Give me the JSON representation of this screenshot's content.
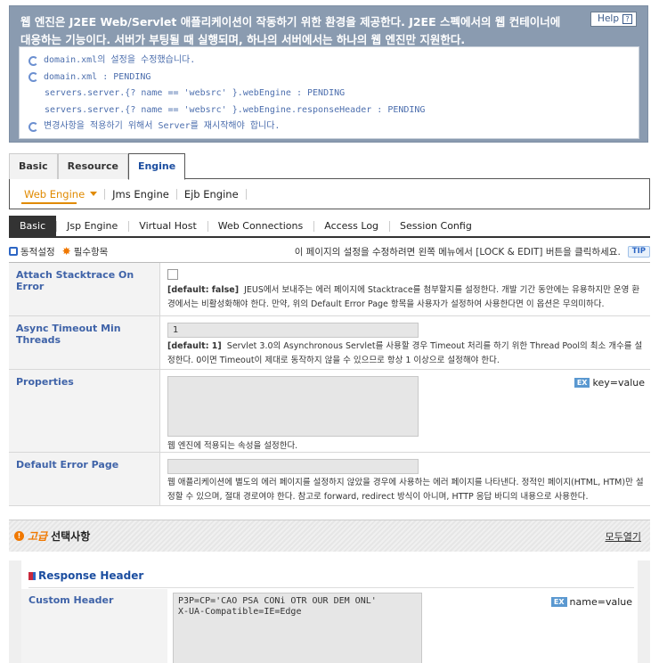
{
  "banner": {
    "title_line1": "웹 엔진은 J2EE Web/Servlet 애플리케이션이 작동하기 위한 환경을 제공한다. J2EE 스펙에서의 웹 컨테이너에",
    "title_line2": "대응하는 기능이다. 서버가 부팅될 때 실행되며, 하나의 서버에서는 하나의 웹 엔진만 지원한다.",
    "help_label": "Help",
    "messages": [
      "domain.xml의 설정을 수정했습니다.",
      "domain.xml : PENDING",
      "servers.server.{? name == 'websrc' }.webEngine : PENDING",
      "servers.server.{? name == 'websrc' }.webEngine.responseHeader : PENDING",
      "변경사항을 적용하기 위해서 Server를 재시작해야 합니다."
    ]
  },
  "main_tabs": [
    "Basic",
    "Resource",
    "Engine"
  ],
  "sub_menu": [
    "Web Engine",
    "Jms Engine",
    "Ejb Engine"
  ],
  "engine_tabs": [
    "Basic",
    "Jsp Engine",
    "Virtual Host",
    "Web Connections",
    "Access Log",
    "Session Config"
  ],
  "legend": {
    "dynamic": "동적설정",
    "required": "필수항목",
    "info": "이 페이지의 설정을 수정하려면 왼쪽 메뉴에서 [LOCK & EDIT] 버튼을 클릭하세요.",
    "tip": "TIP"
  },
  "fields": {
    "attach": {
      "label": "Attach Stacktrace On Error",
      "default": "[default: false]",
      "desc": "JEUS에서 보내주는 에러 페이지에 Stacktrace를 첨부할지를 설정한다. 개발 기간 동안에는 유용하지만 운영 환경에서는 비활성화해야 한다. 만약, 위의 Default Error Page 항목을 사용자가 설정하여 사용한다면 이 옵션은 무의미하다."
    },
    "async": {
      "label": "Async Timeout Min Threads",
      "value": "1",
      "default": "[default: 1]",
      "desc": "Servlet 3.0의 Asynchronous Servlet를 사용할 경우 Timeout 처리를 하기 위한 Thread Pool의 최소 개수를 설정한다. 0이면 Timeout이 제대로 동작하지 않을 수 있으므로 항상 1 이상으로 설정해야 한다."
    },
    "properties": {
      "label": "Properties",
      "ex_label": "EX",
      "ex_value": "key=value",
      "desc": "웹 엔진에 적용되는 속성을 설정한다."
    },
    "error_page": {
      "label": "Default Error Page",
      "desc": "웹 애플리케이션에 별도의 에러 페이지를 설정하지 않았을 경우에 사용하는 에러 페이지를 나타낸다. 정적인 페이지(HTML, HTM)만 설정할 수 있으며, 절대 경로여야 한다. 참고로 forward, redirect 방식이 아니며, HTTP 응답 바디의 내용으로 사용한다."
    }
  },
  "advanced": {
    "tag": "고급",
    "title": "선택사항",
    "open_all": "모두열기"
  },
  "response_header": {
    "title": "Response Header",
    "label": "Custom Header",
    "value": "P3P=CP='CAO PSA CONi OTR OUR DEM ONL'\nX-UA-Compatible=IE=Edge",
    "ex_label": "EX",
    "ex_value": "name=value"
  }
}
